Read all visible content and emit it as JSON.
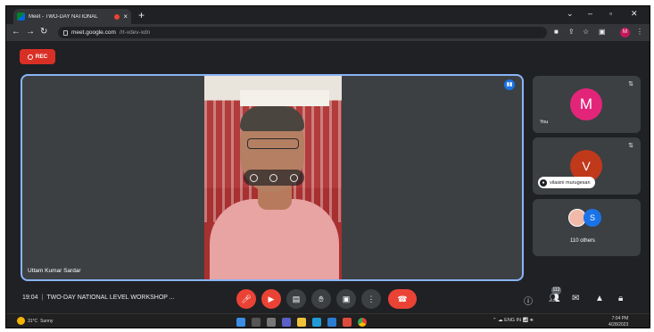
{
  "browser": {
    "tab_title": "Meet - TWO-DAY NATIONAL",
    "tab_close": "×",
    "new_tab": "+",
    "window_controls": {
      "chevron": "⌄",
      "minimize": "–",
      "maximize": "▫",
      "close": "✕"
    },
    "url_host": "meet.google.com",
    "url_path": "/rt-vdev-xdn",
    "profile_initial": "M"
  },
  "meet": {
    "rec_label": "REC",
    "main_speaker": "Uttam Kumar Sardar",
    "tiles": [
      {
        "initial": "M",
        "name": "You",
        "color": "#e3257a"
      },
      {
        "initial": "V",
        "name": "vilasini murugesan",
        "color": "#c0391b"
      },
      {
        "initials": [
          "S"
        ],
        "name": "110 others",
        "color": "#1a73e8"
      }
    ],
    "time": "19:04",
    "meeting_title": "TWO-DAY NATIONAL LEVEL WORKSHOP ...",
    "participant_count": "112"
  },
  "taskbar": {
    "weather_temp": "31°C",
    "weather_desc": "Sunny",
    "lang": "ENG",
    "region": "IN",
    "clock_time": "7:04 PM",
    "clock_date": "4/28/2023"
  }
}
